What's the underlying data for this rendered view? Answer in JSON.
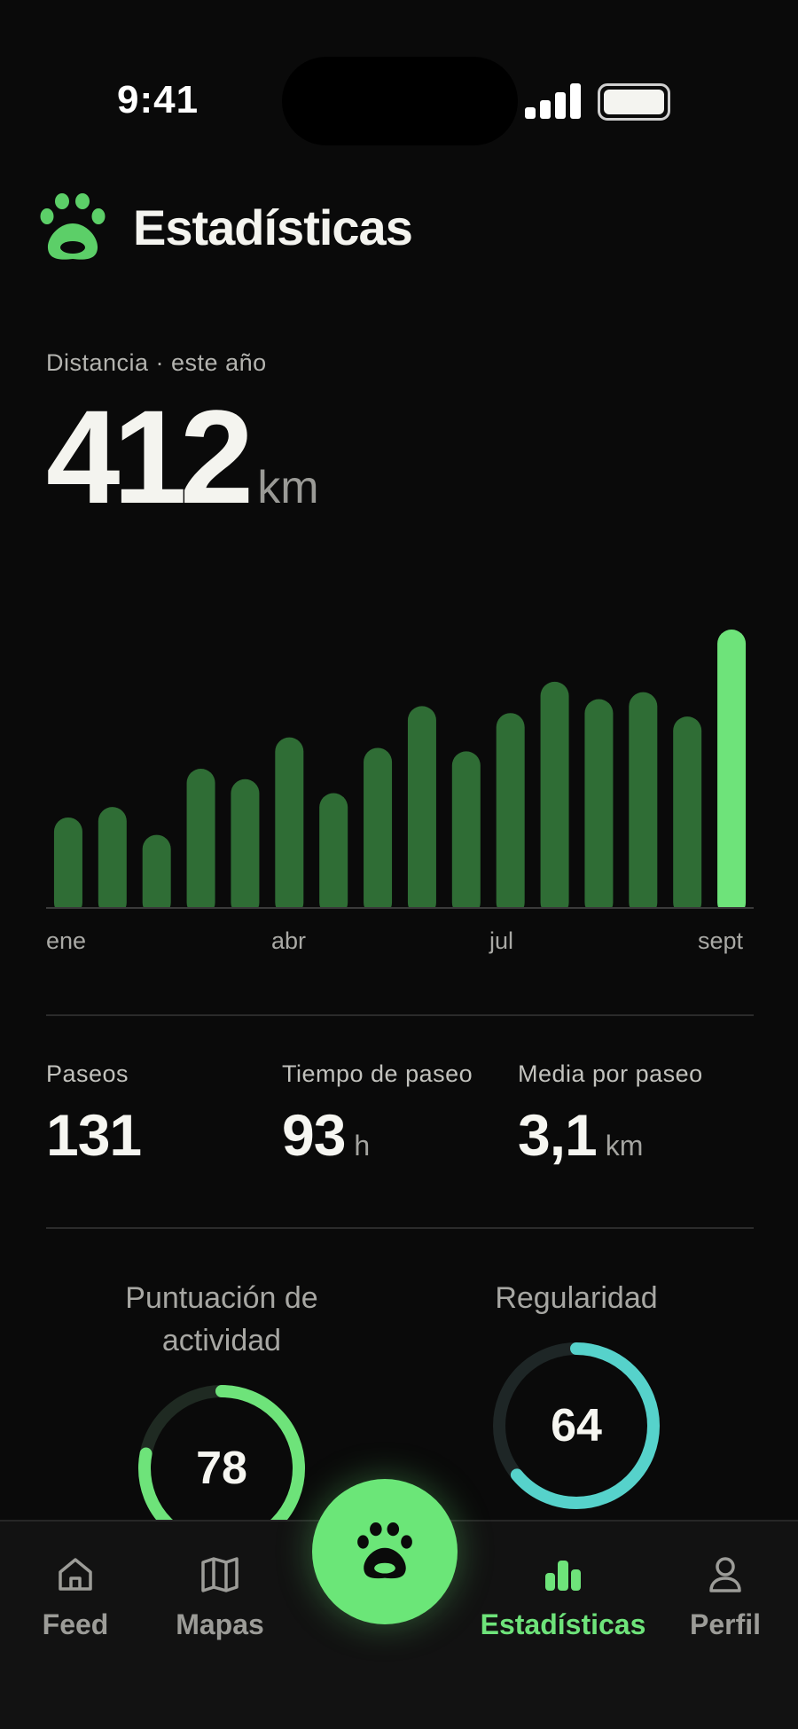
{
  "status_bar": {
    "time": "9:41"
  },
  "header": {
    "title": "Estadísticas"
  },
  "distance": {
    "label": "Distancia · este año",
    "value": "412",
    "unit": "km"
  },
  "chart_data": {
    "type": "bar",
    "values": [
      26,
      29,
      21,
      40,
      37,
      49,
      33,
      46,
      58,
      45,
      56,
      65,
      60,
      62,
      55,
      80
    ],
    "month_labels": [
      "ene",
      "abr",
      "jul",
      "sept"
    ],
    "ylim": [
      0,
      80
    ],
    "colors": {
      "bar": "#2f6d35",
      "highlight": "#6ee37a"
    }
  },
  "stats": [
    {
      "label": "Paseos",
      "value": "131",
      "unit": ""
    },
    {
      "label": "Tiempo de paseo",
      "value": "93",
      "unit": "h"
    },
    {
      "label": "Media por paseo",
      "value": "3,1",
      "unit": "km"
    }
  ],
  "gauges": [
    {
      "title_line1": "Puntuación de",
      "title_line2": "actividad",
      "value": "78",
      "fraction": 0.78,
      "color": "#6ee37a"
    },
    {
      "title_line1": "Regularidad",
      "value": "64",
      "fraction": 0.64,
      "color": "#56d2cb"
    }
  ],
  "nav": {
    "items": [
      {
        "label": "Feed",
        "icon": "home-icon"
      },
      {
        "label": "Mapas",
        "icon": "map-icon"
      },
      {
        "label": "Estadísticas",
        "icon": "bar-chart-icon",
        "active": true
      },
      {
        "label": "Perfil",
        "icon": "user-icon"
      }
    ],
    "center_icon": "paw-icon"
  },
  "colors": {
    "accent": "#6ee37a",
    "background": "#0a0a0a",
    "teal": "#56d2cb"
  }
}
